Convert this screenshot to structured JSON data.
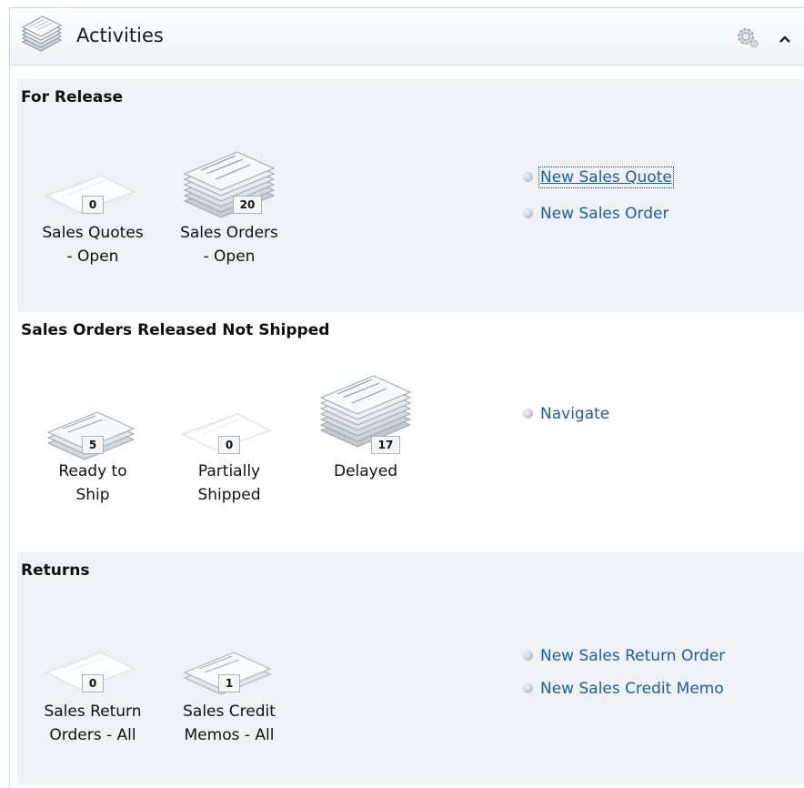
{
  "header": {
    "title": "Activities"
  },
  "sections": [
    {
      "title": "For Release",
      "tiles": [
        {
          "count": "0",
          "label_line1": "Sales Quotes",
          "label_line2": "- Open"
        },
        {
          "count": "20",
          "label_line1": "Sales Orders",
          "label_line2": "- Open"
        }
      ],
      "links": [
        "New Sales Quote",
        "New Sales Order"
      ]
    },
    {
      "title": "Sales Orders Released Not Shipped",
      "tiles": [
        {
          "count": "5",
          "label_line1": "Ready to",
          "label_line2": "Ship"
        },
        {
          "count": "0",
          "label_line1": "Partially",
          "label_line2": "Shipped"
        },
        {
          "count": "17",
          "label_line1": "Delayed",
          "label_line2": ""
        }
      ],
      "links": [
        "Navigate"
      ]
    },
    {
      "title": "Returns",
      "tiles": [
        {
          "count": "0",
          "label_line1": "Sales Return",
          "label_line2": "Orders - All"
        },
        {
          "count": "1",
          "label_line1": "Sales Credit",
          "label_line2": "Memos - All"
        }
      ],
      "links": [
        "New Sales Return Order",
        "New Sales Credit Memo"
      ]
    }
  ],
  "icons": {
    "header": "stacked-documents-icon",
    "settings": "gear-icon",
    "collapse": "chevron-up-icon"
  }
}
